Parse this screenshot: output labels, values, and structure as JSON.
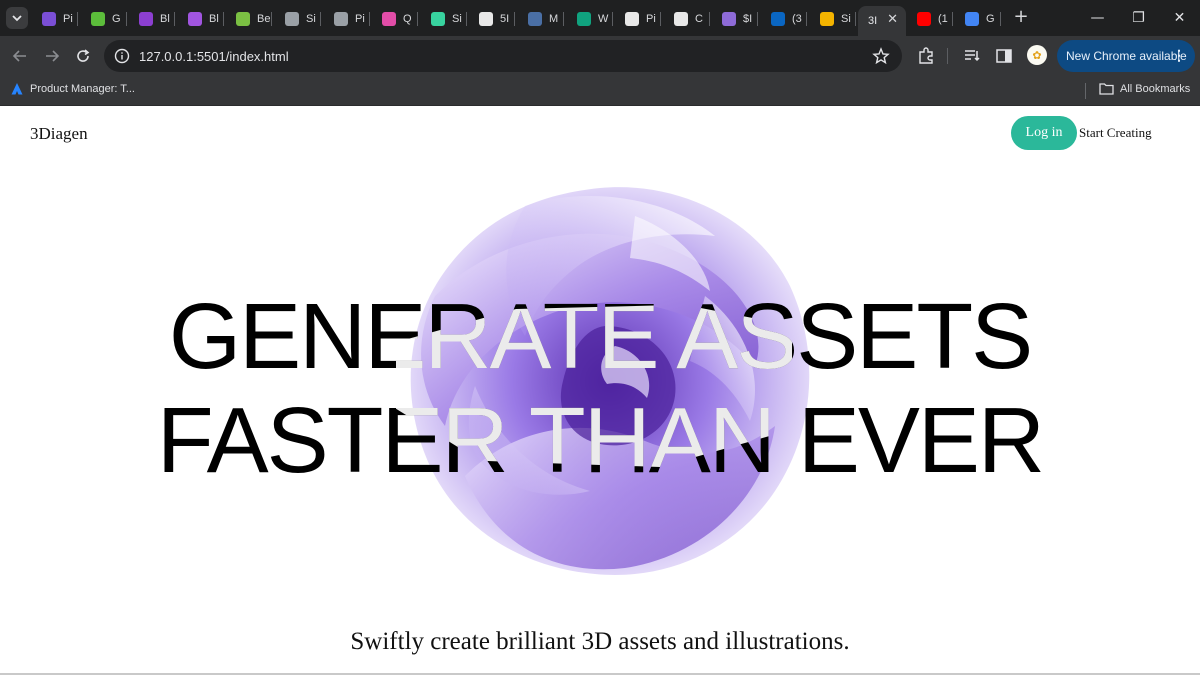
{
  "browser": {
    "tabs": [
      {
        "label": "Pi",
        "favicon": "purple-cube-icon",
        "color": "#7b4fd6"
      },
      {
        "label": "G",
        "favicon": "bar-chart-icon",
        "color": "#5cbd3b"
      },
      {
        "label": "Bl",
        "favicon": "purple-cube-icon",
        "color": "#8c3fd1"
      },
      {
        "label": "Bl",
        "favicon": "purple-cube-icon",
        "color": "#a155e0"
      },
      {
        "label": "Be",
        "favicon": "pc-icon",
        "color": "#7bc043"
      },
      {
        "label": "Si",
        "favicon": "hash-circle-icon",
        "color": "#9aa0a6"
      },
      {
        "label": "Pi",
        "favicon": "circle-icon",
        "color": "#9aa0a6"
      },
      {
        "label": "Q",
        "favicon": "grid-icon",
        "color": "#e24da8"
      },
      {
        "label": "Si",
        "favicon": "bolt-icon",
        "color": "#38d39f"
      },
      {
        "label": "5I",
        "favicon": "skull-icon",
        "color": "#e8e8e8"
      },
      {
        "label": "M",
        "favicon": "plane-icon",
        "color": "#4a6fa5"
      },
      {
        "label": "W",
        "favicon": "openai-icon",
        "color": "#10a37f"
      },
      {
        "label": "Pi",
        "favicon": "github-icon",
        "color": "#e8e8e8"
      },
      {
        "label": "C",
        "favicon": "bars-circle-icon",
        "color": "#e8e8e8"
      },
      {
        "label": "$I",
        "favicon": "spiral-icon",
        "color": "#8e6bd8"
      },
      {
        "label": "(3",
        "favicon": "linkedin-icon",
        "color": "#0a66c2"
      },
      {
        "label": "Si",
        "favicon": "colorful-s-icon",
        "color": "#f4b400"
      },
      {
        "label": "3I",
        "favicon": "page-icon",
        "color": "#ffffff",
        "active": true
      },
      {
        "label": "(1",
        "favicon": "youtube-icon",
        "color": "#ff0000"
      },
      {
        "label": "G",
        "favicon": "google-icon",
        "color": "#4285f4"
      }
    ],
    "new_tab": "+",
    "close": "✕",
    "url": "127.0.0.1:5501/index.html",
    "update_label": "New Chrome available",
    "update_color": "#0d4a83",
    "bookmark": "Product Manager: T...",
    "all_bookmarks": "All Bookmarks"
  },
  "site": {
    "brand": "3Diagen",
    "login": "Log in",
    "start": "Start Creating",
    "hero_line1": "GENERATE ASSETS",
    "hero_line2": "FASTER THAN EVER",
    "tagline": "Swiftly create brilliant 3D assets and illustrations.",
    "accent": "#2bb89a"
  }
}
